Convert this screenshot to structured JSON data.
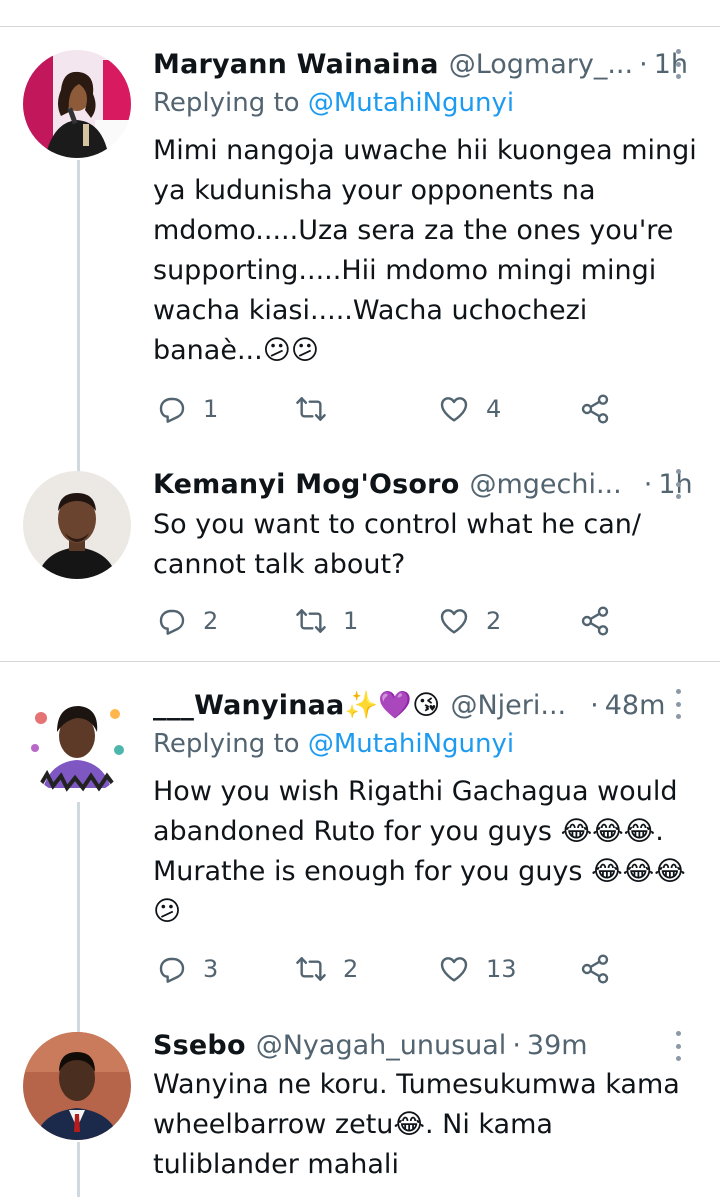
{
  "tweets": [
    {
      "name": "Maryann Wainaina",
      "handle": "@Logmary_...",
      "separator": "·",
      "time": "1h",
      "replying_prefix": "Replying to ",
      "replying_to": "@MutahiNgunyi",
      "text": "Mimi nangoja uwache hii kuongea mingi\nya kudunisha your opponents na\nmdomo.....Uza sera za the ones you're\nsupporting.....Hii mdomo mingi mingi\nwacha kiasi.....Wacha uchochezi\nbanaè...😕😕",
      "replies": "1",
      "retweets": "",
      "likes": "4",
      "avatar_icon": "profile-photo-woman-microphone"
    },
    {
      "name": "Kemanyi Mog'Osoro",
      "handle": "@mgechi...",
      "separator": "·",
      "time": "1h",
      "text": "So you want to control what he can/\ncannot talk about?",
      "replies": "2",
      "retweets": "1",
      "likes": "2",
      "avatar_icon": "profile-photo-man"
    },
    {
      "name": "___Wanyinaa✨💜😘",
      "handle": "@Njeri...",
      "separator": "·",
      "time": "48m",
      "replying_prefix": "Replying to ",
      "replying_to": "@MutahiNgunyi",
      "text": "How you wish Rigathi Gachagua would\nabandoned Ruto for you guys 😂😂😂.\nMurathe is enough for you guys 😂😂😂\n😕",
      "replies": "3",
      "retweets": "2",
      "likes": "13",
      "avatar_icon": "profile-photo-woman-splash"
    },
    {
      "name": "Ssebo",
      "handle": "@Nyagah_unusual",
      "separator": "·",
      "time": "39m",
      "text": "Wanyina ne koru. Tumesukumwa kama\nwheelbarrow zetu😂. Ni kama\ntuliblander mahali",
      "avatar_icon": "profile-photo-young-man"
    }
  ],
  "icons": {
    "reply": "reply-icon",
    "retweet": "retweet-icon",
    "like": "heart-icon",
    "share": "share-icon",
    "more": "more-options-icon"
  },
  "colors": {
    "text": "#0f1419",
    "secondary": "#536471",
    "link": "#1d9bf0",
    "divider": "#d6d6d6",
    "thread_line": "#cfd9de"
  }
}
